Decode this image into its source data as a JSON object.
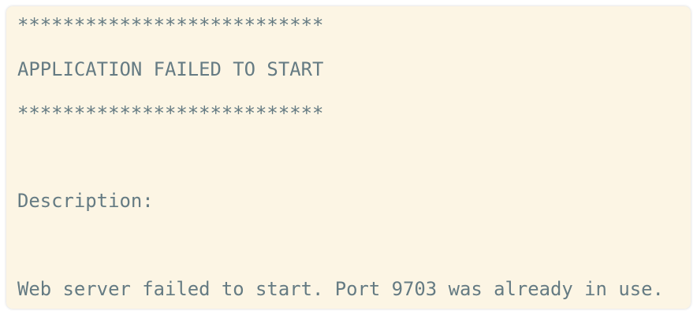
{
  "console": {
    "lines": [
      "***************************",
      "APPLICATION FAILED TO START",
      "***************************",
      "",
      "Description:",
      "",
      "Web server failed to start. Port 9703 was already in use."
    ]
  },
  "colors": {
    "background": "#fcf5e4",
    "text": "#657b83"
  }
}
